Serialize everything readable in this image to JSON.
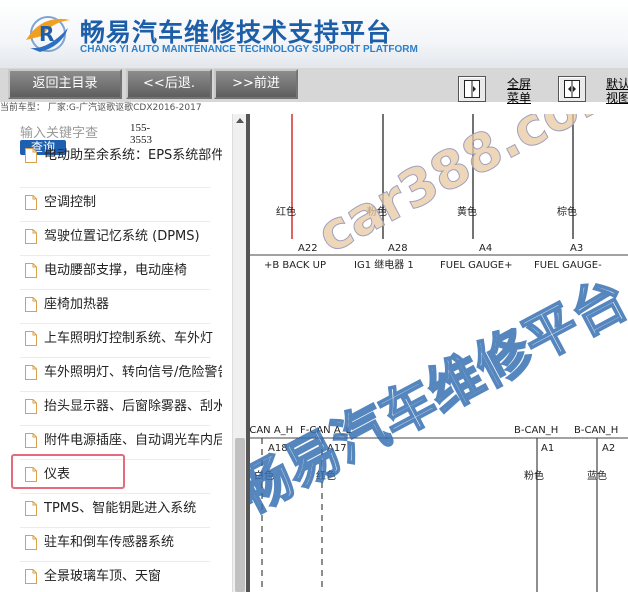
{
  "header": {
    "title_cn": "畅易汽车维修技术支持平台",
    "title_en": "CHANG YI AUTO MAINTENANCE TECHNOLOGY SUPPORT PLATFORM"
  },
  "toolbar": {
    "back_main": "返回主目录",
    "back": "<<后退.",
    "forward": ">>前进",
    "fullscreen_1": "全屏",
    "fullscreen_2": "菜单",
    "default_1": "默认",
    "default_2": "视图"
  },
  "car_info": "当前车型：  厂家:G-广汽讴歌讴歌CDX2016-2017",
  "search": {
    "placeholder": "输入关键字查",
    "query_label": "查询",
    "code_1": "155-",
    "code_2": "3553"
  },
  "list": [
    "电动助至余系统：EPS系统部件",
    "空调控制",
    "驾驶位置记忆系统 (DPMS)",
    "电动腰部支撑，电动座椅",
    "座椅加热器",
    "上车照明灯控制系统、车外灯",
    "车外照明灯、转向信号/危险警告",
    "抬头显示器、后窗除雾器、刮水器",
    "附件电源插座、自动调光车内后视",
    "仪表",
    "TPMS、智能钥匙进入系统",
    "驻车和倒车传感器系统",
    "全景玻璃车顶、天窗"
  ],
  "diagram": {
    "wire_colors_top": [
      "红色",
      "粉色",
      "黄色",
      "棕色"
    ],
    "pins_top": [
      "A22",
      "A28",
      "A4",
      "A3"
    ],
    "signals_top": [
      "+B BACK UP",
      "IG1 继电器 1",
      "FUEL GAUGE+",
      "FUEL GAUGE-"
    ],
    "signals_bottom": [
      "F-CAN A_H",
      "F-CAN A_L",
      "B-CAN_H",
      "B-CAN_H"
    ],
    "pins_bottom": [
      "A18",
      "A17",
      "A1",
      "A2"
    ],
    "wire_colors_bottom": [
      "白色",
      "红色",
      "粉色",
      "蓝色"
    ],
    "watermark_1": "car388.com",
    "watermark_2": "畅易汽车维修平台"
  },
  "colors": {
    "title_blue": "#1d5ea8",
    "query_blue": "#1e5fb0",
    "highlight_border": "#e36b7c",
    "wire_red": "#d23030"
  }
}
